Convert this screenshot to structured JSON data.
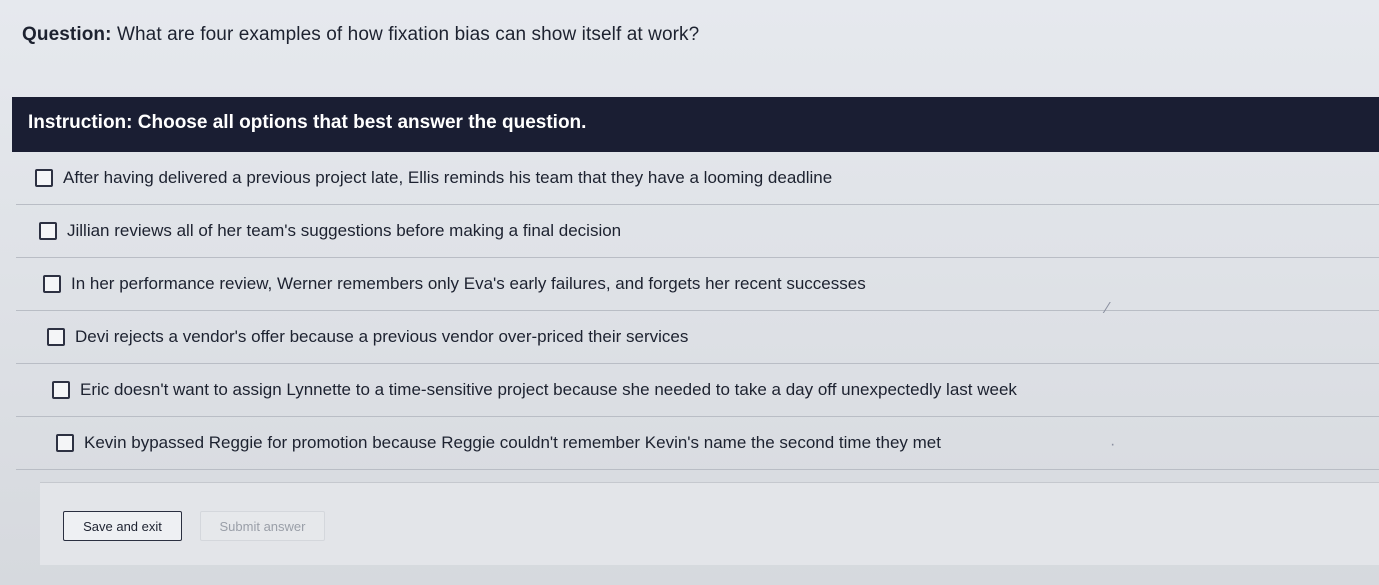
{
  "question": {
    "label": "Question:",
    "text": "What are four examples of how fixation bias can show itself at work?"
  },
  "instruction": {
    "text": "Instruction: Choose all options that best answer the question."
  },
  "options": [
    {
      "label": "After having delivered a previous project late, Ellis reminds his team that they have a looming deadline",
      "checked": false
    },
    {
      "label": "Jillian reviews all of her team's suggestions before making a final decision",
      "checked": false
    },
    {
      "label": "In her performance review, Werner remembers only Eva's early failures, and forgets her recent successes",
      "checked": false
    },
    {
      "label": "Devi rejects a vendor's offer because a previous vendor over-priced their services",
      "checked": false
    },
    {
      "label": "Eric doesn't want to assign Lynnette to a time-sensitive project because she needed to take a day off unexpectedly last week",
      "checked": false
    },
    {
      "label": "Kevin bypassed Reggie for promotion because Reggie couldn't remember Kevin's name the second time they met",
      "checked": false
    }
  ],
  "footer": {
    "save_label": "Save and exit",
    "submit_label": "Submit answer"
  },
  "colors": {
    "instruction_bar": "#1a1e33",
    "background": "#e3e5e9"
  }
}
